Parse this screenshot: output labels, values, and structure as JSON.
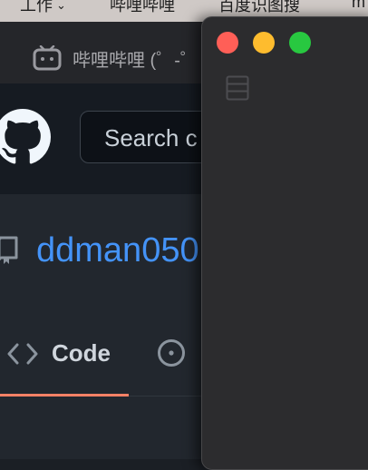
{
  "menubar": {
    "items": [
      {
        "label": "工作",
        "has_chevron": true
      },
      {
        "label": "哔哩哔哩"
      },
      {
        "label": "百度识图搜"
      },
      {
        "label": "m"
      }
    ],
    "chevron_glyph": "⌄"
  },
  "browser": {
    "tab": {
      "title": "哔哩哔哩 (゜-゜",
      "icon": "bilibili-icon"
    }
  },
  "github": {
    "logo_icon": "github-mark-icon",
    "search": {
      "placeholder": "Search c"
    },
    "repo": {
      "name": "ddman050",
      "icon": "repo-icon"
    },
    "tabs": [
      {
        "label": "Code",
        "icon": "code-icon",
        "selected": true
      },
      {
        "label": "",
        "icon": "issue-opened-icon",
        "selected": false
      }
    ]
  },
  "window": {
    "traffic_lights": [
      "close",
      "minimize",
      "zoom"
    ],
    "sidebar_icon": "sidebar-icon"
  },
  "colors": {
    "menubar_bg": "#cfc9c6",
    "tabbar_bg": "#25262a",
    "header_bg": "#161b22",
    "content_bg": "#22272e",
    "link": "#4493f8",
    "tab_underline": "#f78166",
    "window_bg": "#2c2c2e"
  }
}
